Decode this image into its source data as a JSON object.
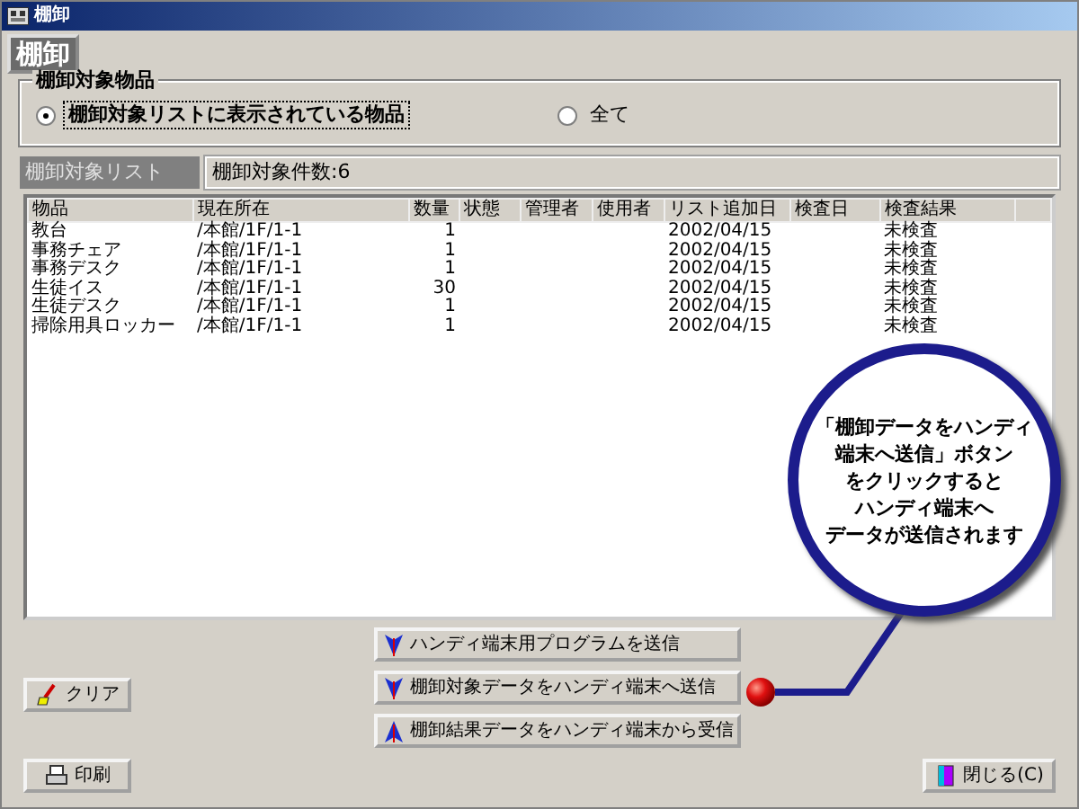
{
  "window": {
    "title": "棚卸"
  },
  "header": "棚卸",
  "target_group": {
    "legend": "棚卸対象物品",
    "options": [
      {
        "label": "棚卸対象リストに表示されている物品",
        "selected": true
      },
      {
        "label": "全て",
        "selected": false
      }
    ]
  },
  "list_bar": {
    "label": "棚卸対象リスト",
    "count": "棚卸対象件数:6"
  },
  "table": {
    "columns": [
      "物品",
      "現在所在",
      "数量",
      "状態",
      "管理者",
      "使用者",
      "リスト追加日",
      "検査日",
      "検査結果"
    ],
    "rows": [
      [
        "教台",
        "/本館/1F/1-1",
        "1",
        "",
        "",
        "",
        "2002/04/15",
        "",
        "未検査"
      ],
      [
        "事務チェア",
        "/本館/1F/1-1",
        "1",
        "",
        "",
        "",
        "2002/04/15",
        "",
        "未検査"
      ],
      [
        "事務デスク",
        "/本館/1F/1-1",
        "1",
        "",
        "",
        "",
        "2002/04/15",
        "",
        "未検査"
      ],
      [
        "生徒イス",
        "/本館/1F/1-1",
        "30",
        "",
        "",
        "",
        "2002/04/15",
        "",
        "未検査"
      ],
      [
        "生徒デスク",
        "/本館/1F/1-1",
        "1",
        "",
        "",
        "",
        "2002/04/15",
        "",
        "未検査"
      ],
      [
        "掃除用具ロッカー",
        "/本館/1F/1-1",
        "1",
        "",
        "",
        "",
        "2002/04/15",
        "",
        "未検査"
      ]
    ]
  },
  "left_buttons": [
    {
      "kind": "clear",
      "label": "クリア"
    },
    {
      "kind": "print",
      "label": "印刷"
    }
  ],
  "transfer_buttons": [
    {
      "kind": "down",
      "label": "ハンディ端末用プログラムを送信"
    },
    {
      "kind": "down",
      "label": "棚卸対象データをハンディ端末へ送信"
    },
    {
      "kind": "up",
      "label": "棚卸結果データをハンディ端末から受信"
    }
  ],
  "close_button": {
    "label": "閉じる(C)"
  },
  "callout": {
    "lines": [
      "「棚卸データをハンディ",
      "端末へ送信」ボタン",
      "をクリックすると",
      "ハンディ端末へ",
      "データが送信されます"
    ]
  }
}
